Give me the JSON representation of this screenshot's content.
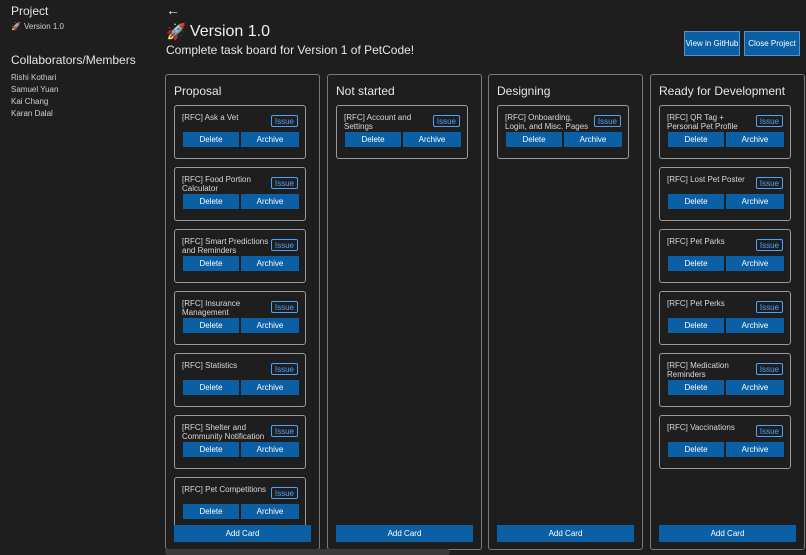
{
  "sidebar": {
    "project_title": "Project",
    "version_label": "Version 1.0",
    "collaborators_title": "Collaborators/Members",
    "members": [
      "Rishi Kothari",
      "Samuel Yuan",
      "Kai Chang",
      "Karan Dalal"
    ]
  },
  "header": {
    "back_icon": "←",
    "rocket_icon": "🚀",
    "title": "Version 1.0",
    "subtitle": "Complete task board for Version 1 of PetCode!",
    "view_github_label": "View in GitHub",
    "close_project_label": "Close Project"
  },
  "card_labels": {
    "badge": "Issue",
    "delete": "Delete",
    "archive": "Archive",
    "add_card": "Add Card"
  },
  "columns": [
    {
      "title": "Proposal",
      "cards": [
        {
          "title": "[RFC] Ask a Vet"
        },
        {
          "title": "[RFC] Food Portion Calculator"
        },
        {
          "title": "[RFC] Smart Predictions and Reminders"
        },
        {
          "title": "[RFC] Insurance Management"
        },
        {
          "title": "[RFC] Statistics"
        },
        {
          "title": "[RFC] Shelter and Community Notification"
        },
        {
          "title": "[RFC] Pet Competitions"
        }
      ]
    },
    {
      "title": "Not started",
      "cards": [
        {
          "title": "[RFC] Account and Settings"
        }
      ]
    },
    {
      "title": "Designing",
      "cards": [
        {
          "title": "[RFC] Onboarding, Login, and Misc. Pages"
        }
      ]
    },
    {
      "title": "Ready for Development",
      "cards": [
        {
          "title": "[RFC] QR Tag + Personal Pet Profile"
        },
        {
          "title": "[RFC] Lost Pet Poster"
        },
        {
          "title": "[RFC] Pet Parks"
        },
        {
          "title": "[RFC] Pet Perks"
        },
        {
          "title": "[RFC] Medication Reminders"
        },
        {
          "title": "[RFC] Vaccinations"
        }
      ]
    }
  ],
  "colors": {
    "background": "#1e1e1e",
    "accent": "#0b5fa5",
    "badge": "#4aa3ff"
  }
}
